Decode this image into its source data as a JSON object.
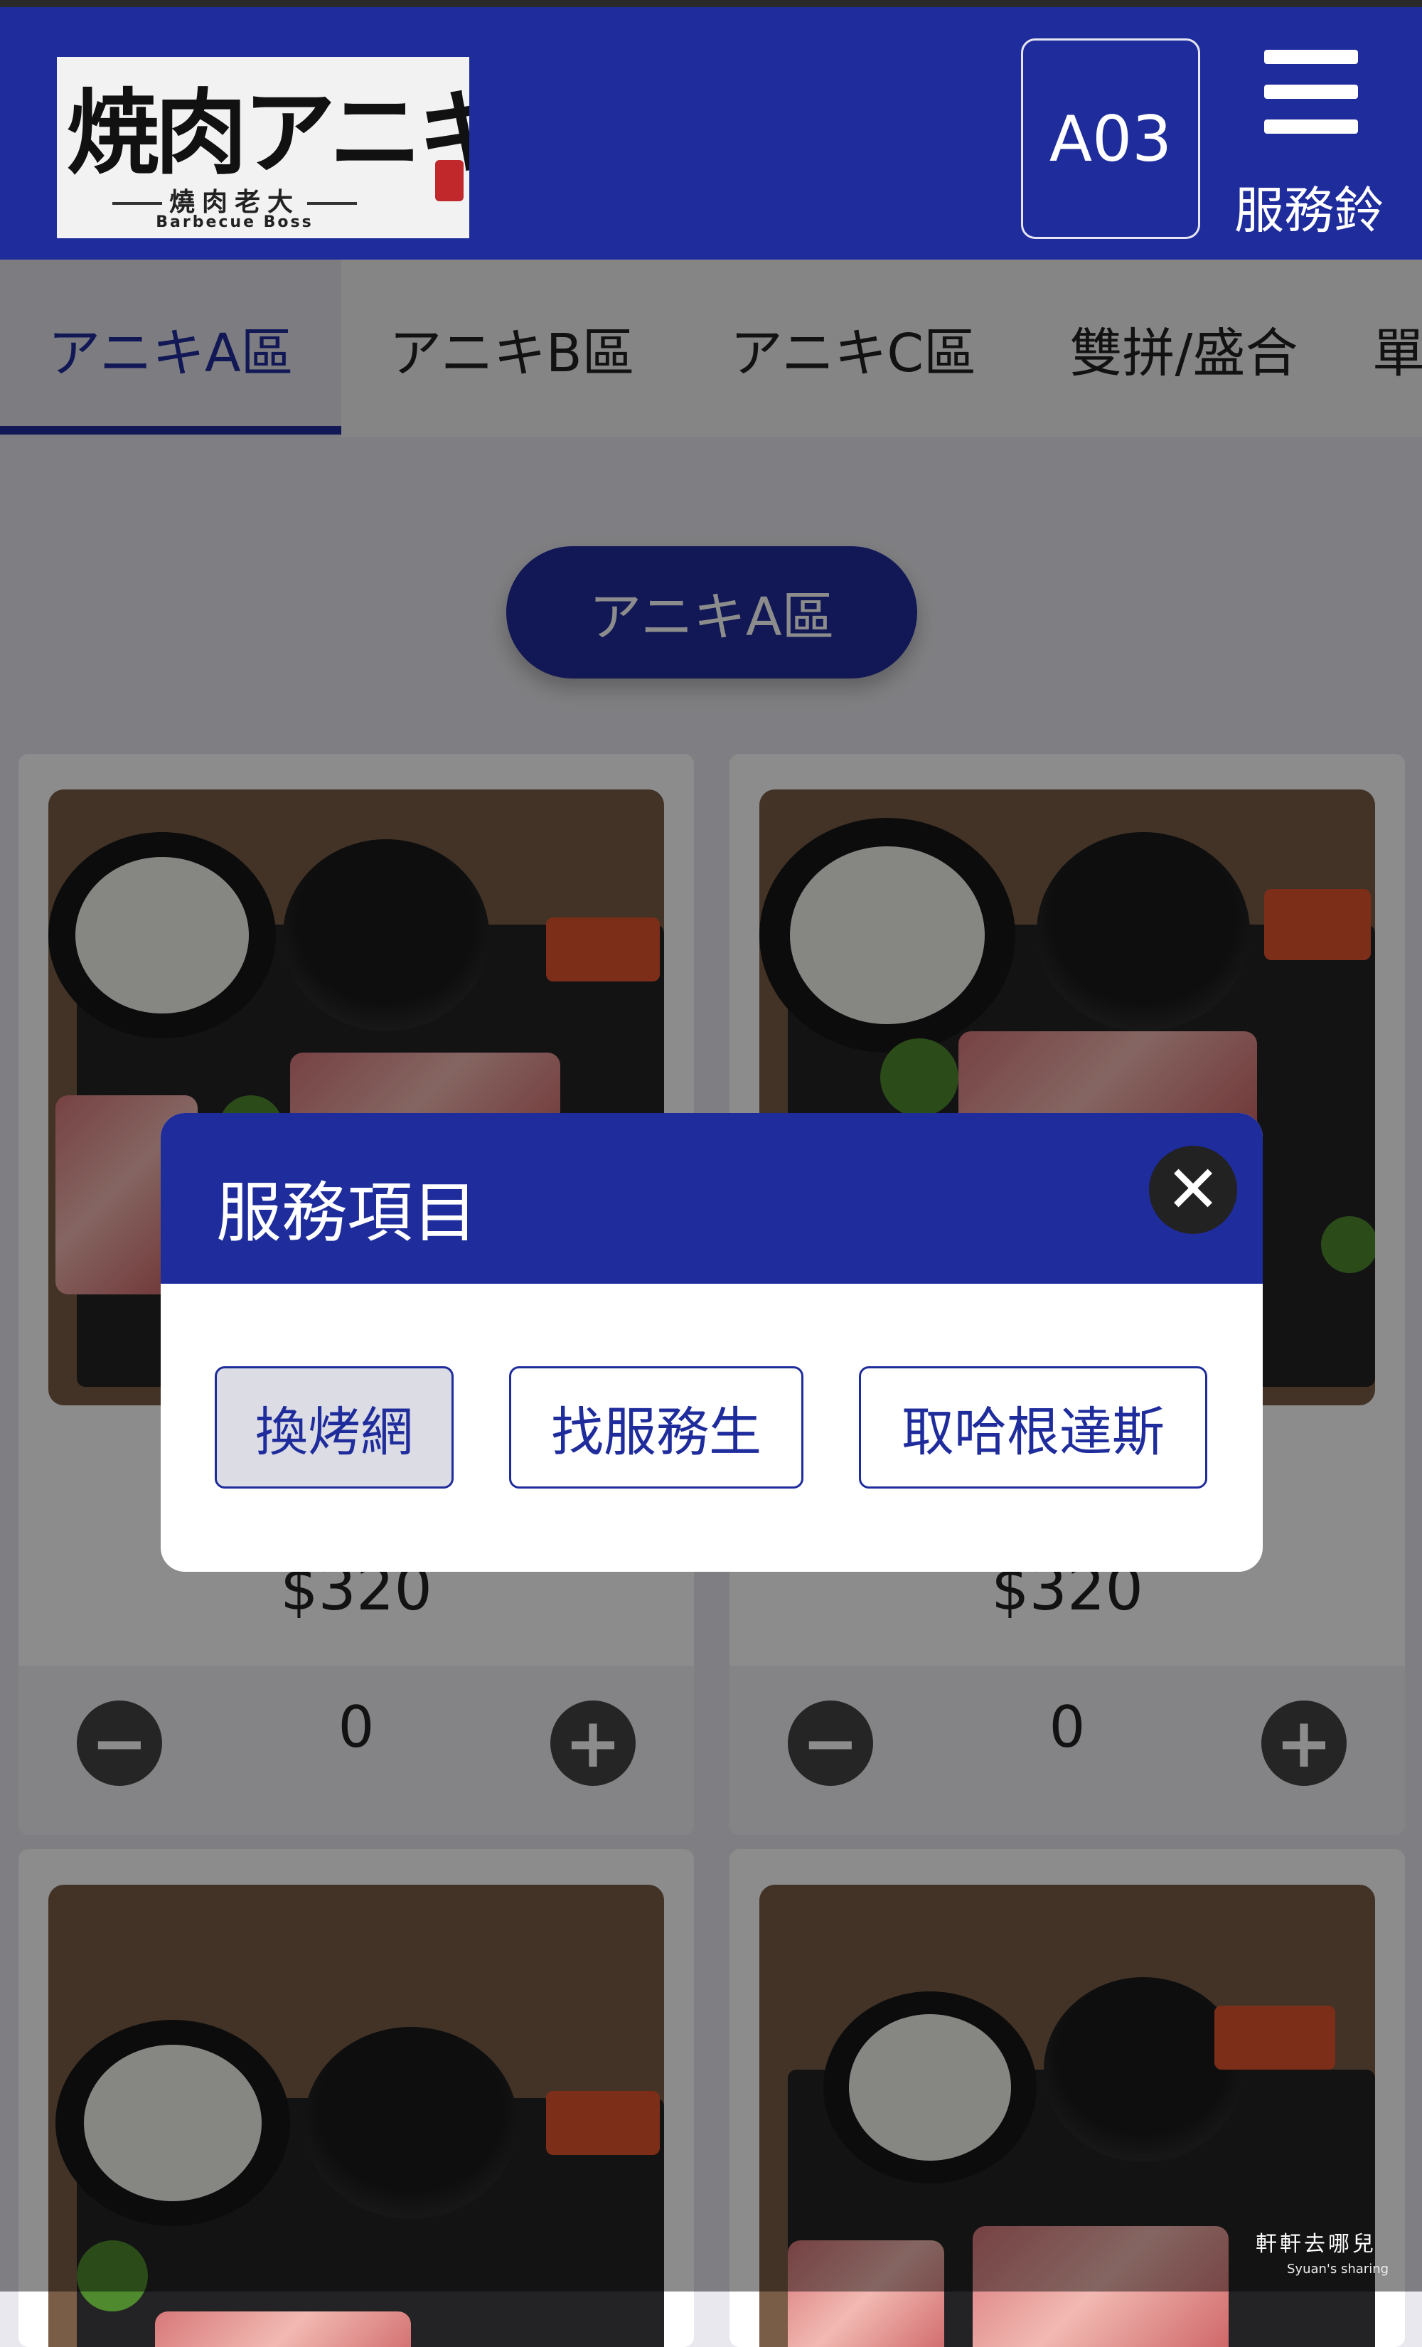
{
  "header": {
    "logo": {
      "main_text": "焼肉アニキ",
      "sub_text": "燒肉老大",
      "en_text": "Barbecue Boss"
    },
    "table_number": "A03",
    "service_bell_label": "服務鈴"
  },
  "tabs": [
    {
      "label": "アニキA區",
      "active": true
    },
    {
      "label": "アニキB區",
      "active": false
    },
    {
      "label": "アニキC區",
      "active": false
    },
    {
      "label": "雙拼/盛合",
      "active": false
    },
    {
      "label": "單",
      "active": false
    }
  ],
  "section": {
    "title": "アニキA區"
  },
  "menu_items": [
    {
      "price": "$320",
      "quantity": "0"
    },
    {
      "price": "$320",
      "quantity": "0"
    },
    {
      "price": "",
      "quantity": ""
    },
    {
      "price": "",
      "quantity": ""
    }
  ],
  "modal": {
    "title": "服務項目",
    "close_icon": "close-icon",
    "options": [
      {
        "label": "換烤網",
        "pressed": true
      },
      {
        "label": "找服務生",
        "pressed": false
      },
      {
        "label": "取哈根達斯",
        "pressed": false
      }
    ]
  },
  "watermark": {
    "text": "軒軒去哪兒",
    "en": "Syuan's sharing"
  },
  "colors": {
    "brand_blue": "#1f2c9c",
    "overlay": "rgba(0,0,0,0.45)"
  }
}
